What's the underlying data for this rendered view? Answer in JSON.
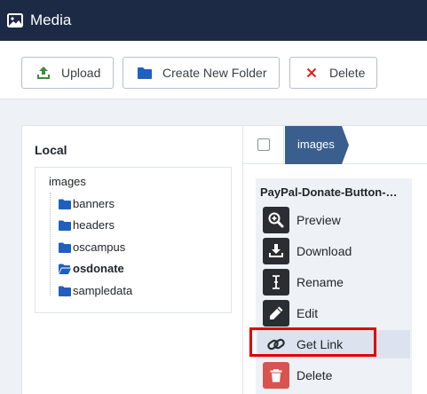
{
  "app": {
    "title": "Media",
    "icon": "image-icon"
  },
  "toolbar": {
    "upload_label": "Upload",
    "create_folder_label": "Create New Folder",
    "delete_label": "Delete",
    "colors": {
      "upload_icon": "#3d8b3d",
      "folder_icon": "#1f5fbf",
      "delete_icon": "#e02020"
    }
  },
  "sidebar": {
    "local_label": "Local",
    "root": "images",
    "folders": [
      {
        "label": "banners",
        "open": false
      },
      {
        "label": "headers",
        "open": false
      },
      {
        "label": "oscampus",
        "open": false
      },
      {
        "label": "osdonate",
        "open": true,
        "selected": true
      },
      {
        "label": "sampledata",
        "open": false
      }
    ],
    "folder_color": "#1f5fbf"
  },
  "breadcrumb": {
    "items": [
      "images"
    ],
    "color": "#3a5f8f"
  },
  "file_card": {
    "name": "PayPal-Donate-Button-…",
    "actions": [
      {
        "label": "Preview",
        "icon": "zoom-in-icon"
      },
      {
        "label": "Download",
        "icon": "download-icon"
      },
      {
        "label": "Rename",
        "icon": "text-cursor-icon"
      },
      {
        "label": "Edit",
        "icon": "pencil-icon"
      },
      {
        "label": "Get Link",
        "icon": "link-icon",
        "active": true
      },
      {
        "label": "Delete",
        "icon": "trash-icon",
        "color": "#d9534f"
      }
    ]
  },
  "highlight_color": "#e00000"
}
